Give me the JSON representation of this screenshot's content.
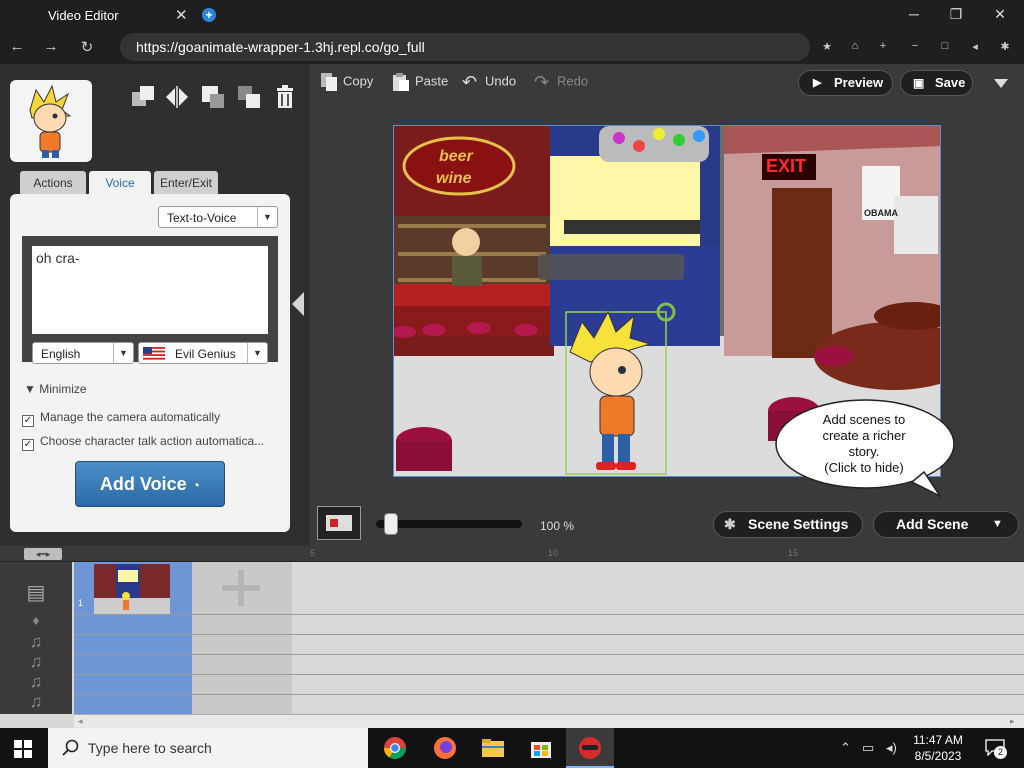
{
  "browser": {
    "tab_title": "Video Editor",
    "tab_close": "✕",
    "new_tab": "+",
    "url": "https://goanimate-wrapper-1.3hj.repl.co/go_full",
    "win_min": "─",
    "win_restore": "❐",
    "win_close": "✕",
    "back": "←",
    "forward": "→",
    "reload": "↻"
  },
  "left_panel": {
    "tabs": [
      "Actions",
      "Voice",
      "Enter/Exit"
    ],
    "active_tab": "Voice",
    "mode_select": "Text-to-Voice",
    "voice_text": "oh cra-",
    "language": "English",
    "voice": "Evil Genius",
    "minimize_label": "Minimize",
    "checkbox_camera": "Manage the camera automatically",
    "checkbox_talk": "Choose character talk action automatica...",
    "add_voice": "Add Voice"
  },
  "toolbar": {
    "copy": "Copy",
    "paste": "Paste",
    "undo": "Undo",
    "redo": "Redo",
    "preview": "Preview",
    "save": "Save"
  },
  "stage": {
    "sign_beer": "beer",
    "sign_wine": "wine",
    "exit_sign": "EXIT",
    "poster_text": "OBAMA",
    "bubble_line1": "Add scenes to",
    "bubble_line2": "create a richer",
    "bubble_line3": "story.",
    "bubble_line4": "(Click to hide)"
  },
  "scene_controls": {
    "zoom": "100 %",
    "scene_settings": "Scene Settings",
    "add_scene": "Add Scene"
  },
  "timeline": {
    "ruler_marks": [
      "5",
      "10",
      "15"
    ],
    "scene_number": "1"
  },
  "taskbar": {
    "search_placeholder": "Type here to search",
    "time": "11:47 AM",
    "date": "8/5/2023",
    "notifications": "2"
  },
  "colors": {
    "accent_blue": "#2b6aa6",
    "stage_border": "#5b8dd6",
    "scene_block": "#6e95d6"
  }
}
